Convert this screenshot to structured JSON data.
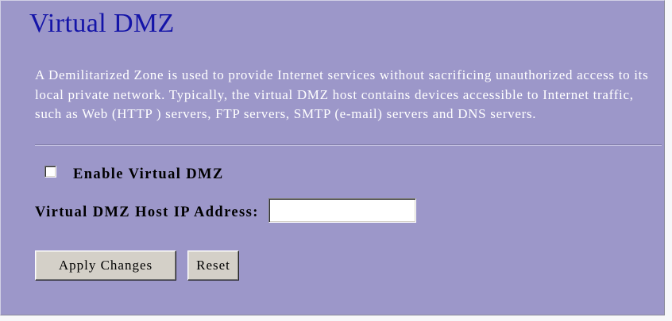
{
  "page": {
    "title": "Virtual DMZ"
  },
  "description_lines": [
    "A Demilitarized Zone is used to provide Internet services without sacrificing unauthorized access to its",
    "local private network. Typically, the virtual DMZ host contains devices accessible to Internet traffic,",
    "such as Web (HTTP ) servers, FTP servers, SMTP (e-mail) servers and DNS servers."
  ],
  "form": {
    "enable_virtual_dmz": {
      "label": "Enable Virtual DMZ",
      "checked": false
    },
    "host_ip": {
      "label": "Virtual DMZ Host IP Address:",
      "value": ""
    },
    "buttons": {
      "apply": "Apply Changes",
      "reset": "Reset"
    }
  },
  "colors": {
    "background": "#9c97c9",
    "title": "#1414a8",
    "description_text": "#ffffff",
    "label_text": "#000000",
    "button_face": "#d4d0c8"
  }
}
